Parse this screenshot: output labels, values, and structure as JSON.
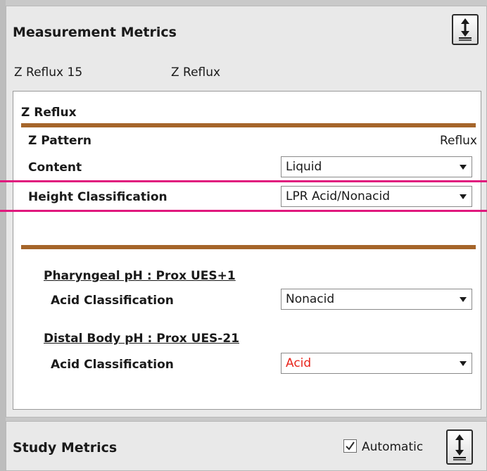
{
  "top_panel": {
    "title": "Measurement Metrics",
    "reflux_id": "Z Reflux 15",
    "reflux_type": "Z Reflux"
  },
  "section": {
    "heading": "Z Reflux",
    "pattern_label": "Z Pattern",
    "pattern_value": "Reflux",
    "content_label": "Content",
    "content_value": "Liquid",
    "height_label": "Height Classification",
    "height_value": "LPR Acid/Nonacid"
  },
  "sensors": [
    {
      "heading": "Pharyngeal pH : Prox UES+1",
      "label": "Acid Classification",
      "value": "Nonacid",
      "value_color": "#1a1a1a"
    },
    {
      "heading": "Distal Body pH : Prox UES-21",
      "label": "Acid Classification",
      "value": "Acid",
      "value_color": "#e8251c"
    }
  ],
  "bottom_panel": {
    "title": "Study Metrics",
    "automatic_label": "Automatic",
    "automatic_checked": true
  },
  "colors": {
    "rule": "#a5652a",
    "highlight": "#e0197d",
    "acid_text": "#e8251c"
  },
  "icons": {
    "expand": "expand-vertical-icon",
    "check": "checkmark-icon",
    "dropdown": "chevron-down-icon"
  }
}
